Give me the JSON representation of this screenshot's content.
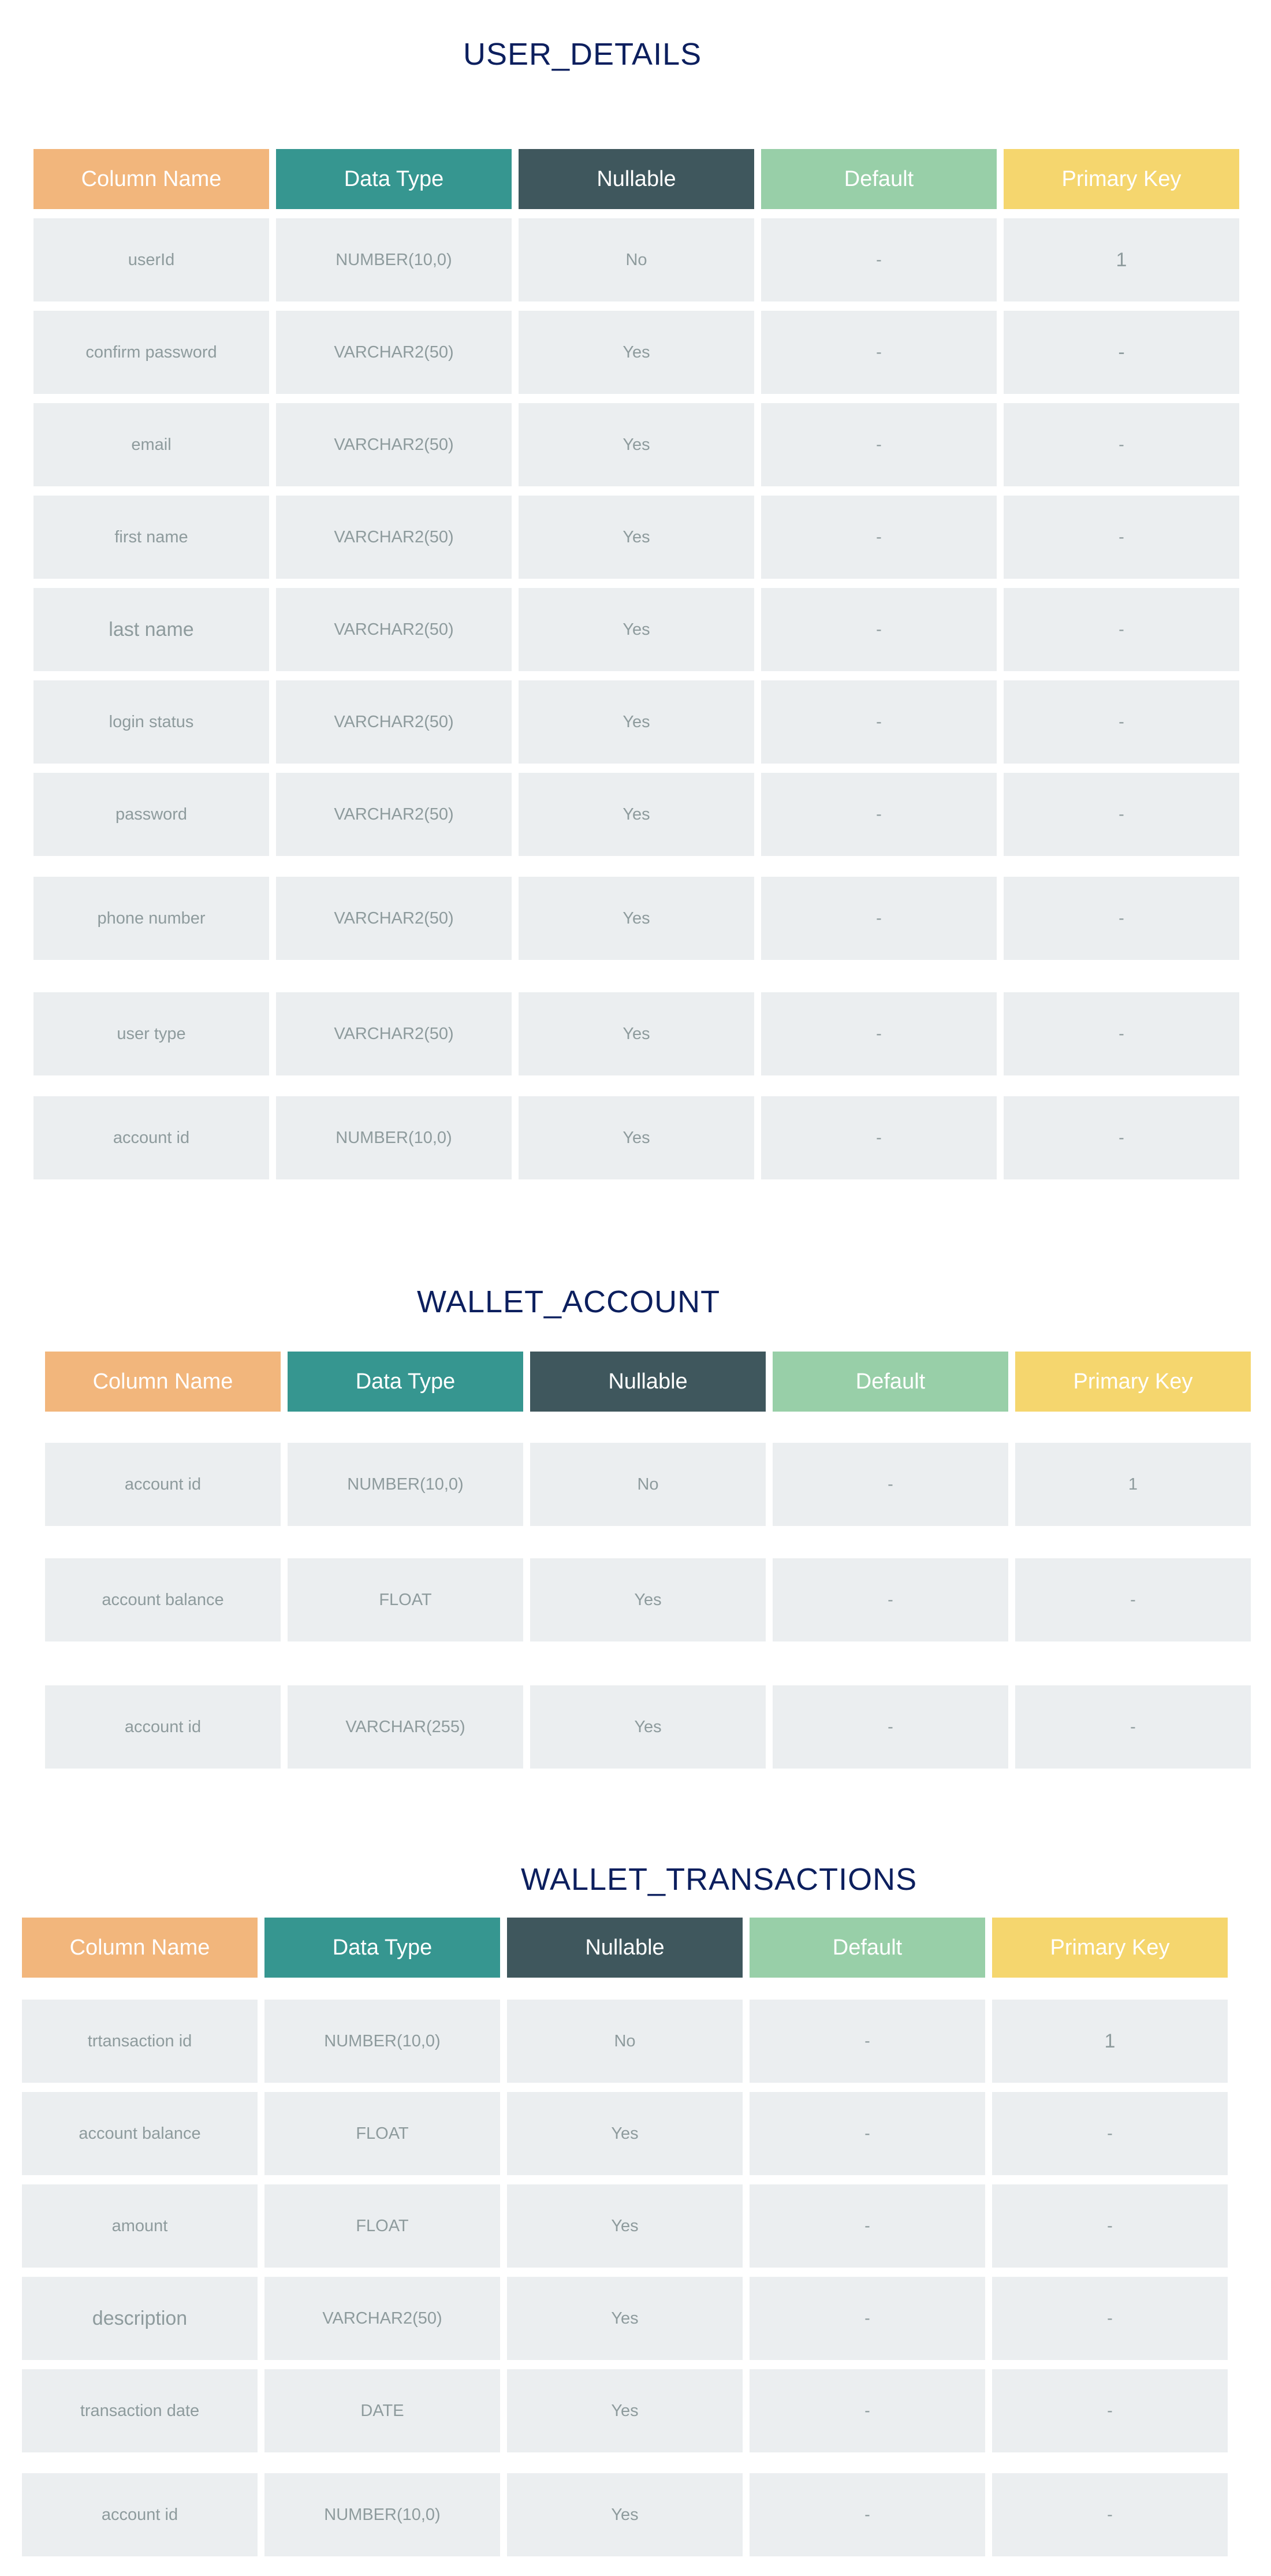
{
  "colors": {
    "column_name": "#f2b67c",
    "data_type": "#369690",
    "nullable": "#3f575d",
    "default": "#98cfa8",
    "primary_key": "#f5d66e",
    "cell_background": "#ebeef0",
    "cell_text": "#8e9b9d",
    "title": "#0c1f5e"
  },
  "header_labels": [
    "Column Name",
    "Data  Type",
    "Nullable",
    "Default",
    "Primary Key"
  ],
  "tables": [
    {
      "title": "USER_DETAILS",
      "rows": [
        [
          "userId",
          "NUMBER(10,0)",
          "No",
          "-",
          "1"
        ],
        [
          "confirm password",
          "VARCHAR2(50)",
          "Yes",
          "-",
          "-"
        ],
        [
          "email",
          "VARCHAR2(50)",
          "Yes",
          "-",
          "-"
        ],
        [
          "first name",
          "VARCHAR2(50)",
          "Yes",
          "-",
          "-"
        ],
        [
          "last name",
          "VARCHAR2(50)",
          "Yes",
          "-",
          "-"
        ],
        [
          "login status",
          "VARCHAR2(50)",
          "Yes",
          "-",
          "-"
        ],
        [
          "password",
          "VARCHAR2(50)",
          "Yes",
          "-",
          "-"
        ],
        [
          "phone number",
          "VARCHAR2(50)",
          "Yes",
          "-",
          "-"
        ],
        [
          "user type",
          "VARCHAR2(50)",
          "Yes",
          "-",
          "-"
        ],
        [
          "account id",
          "NUMBER(10,0)",
          "Yes",
          "-",
          "-"
        ]
      ]
    },
    {
      "title": "WALLET_ACCOUNT",
      "rows": [
        [
          "account id",
          "NUMBER(10,0)",
          "No",
          "-",
          "1"
        ],
        [
          "account balance",
          "FLOAT",
          "Yes",
          "-",
          "-"
        ],
        [
          "account id",
          "VARCHAR(255)",
          "Yes",
          "-",
          "-"
        ]
      ]
    },
    {
      "title": "WALLET_TRANSACTIONS",
      "rows": [
        [
          "trtansaction id",
          "NUMBER(10,0)",
          "No",
          "-",
          "1"
        ],
        [
          "account balance",
          "FLOAT",
          "Yes",
          "-",
          "-"
        ],
        [
          "amount",
          "FLOAT",
          "Yes",
          "-",
          "-"
        ],
        [
          "description",
          "VARCHAR2(50)",
          "Yes",
          "-",
          "-"
        ],
        [
          "transaction date",
          "DATE",
          "Yes",
          "-",
          "-"
        ],
        [
          "account id",
          "NUMBER(10,0)",
          "Yes",
          "-",
          "-"
        ]
      ]
    }
  ]
}
